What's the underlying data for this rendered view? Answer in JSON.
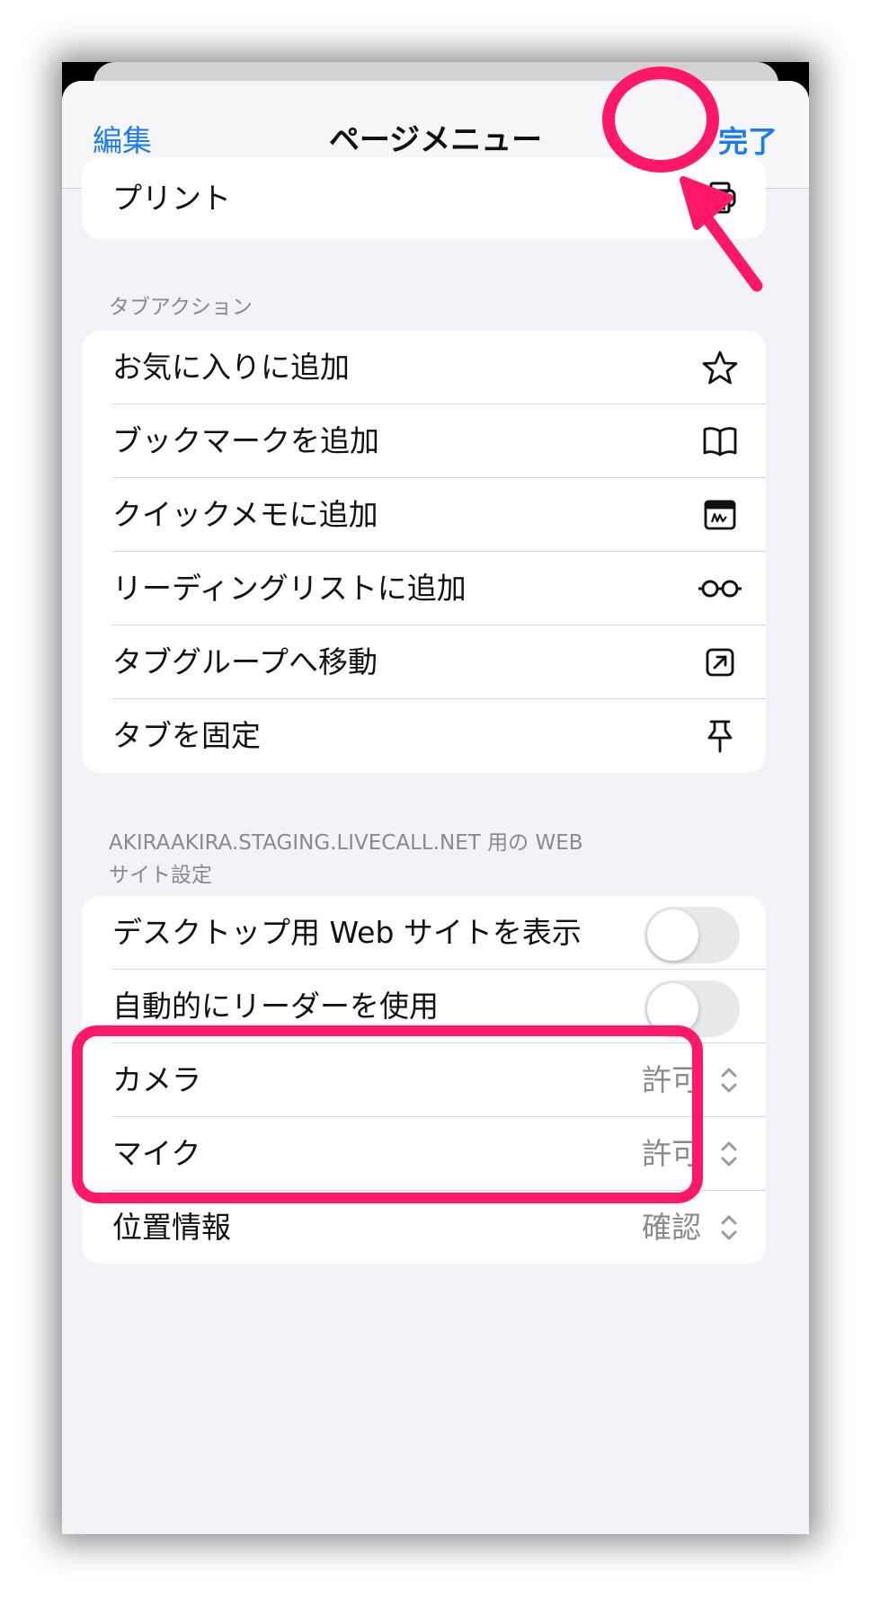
{
  "navbar": {
    "edit_label": "編集",
    "title": "ページメニュー",
    "done_label": "完了"
  },
  "print_row": {
    "label": "プリント",
    "icon": "printer-icon"
  },
  "tab_actions": {
    "header": "タブアクション",
    "items": [
      {
        "label": "お気に入りに追加",
        "icon": "star-icon"
      },
      {
        "label": "ブックマークを追加",
        "icon": "book-icon"
      },
      {
        "label": "クイックメモに追加",
        "icon": "quick-note-icon"
      },
      {
        "label": "リーディングリストに追加",
        "icon": "glasses-icon"
      },
      {
        "label": "タブグループへ移動",
        "icon": "move-arrow-icon"
      },
      {
        "label": "タブを固定",
        "icon": "pin-icon"
      }
    ]
  },
  "website_settings": {
    "header_line1": "AKIRAAKIRA.STAGING.LIVECALL.NET 用の WEB",
    "header_line2": "サイト設定",
    "toggles": [
      {
        "label": "デスクトップ用 Web サイトを表示",
        "on": false
      },
      {
        "label": "自動的にリーダーを使用",
        "on": false
      }
    ],
    "permissions": [
      {
        "label": "カメラ",
        "value": "許可"
      },
      {
        "label": "マイク",
        "value": "許可"
      },
      {
        "label": "位置情報",
        "value": "確認"
      }
    ]
  },
  "colors": {
    "accent": "#1a7cf1",
    "highlight": "#ff1868",
    "background": "#f2f2f7"
  }
}
